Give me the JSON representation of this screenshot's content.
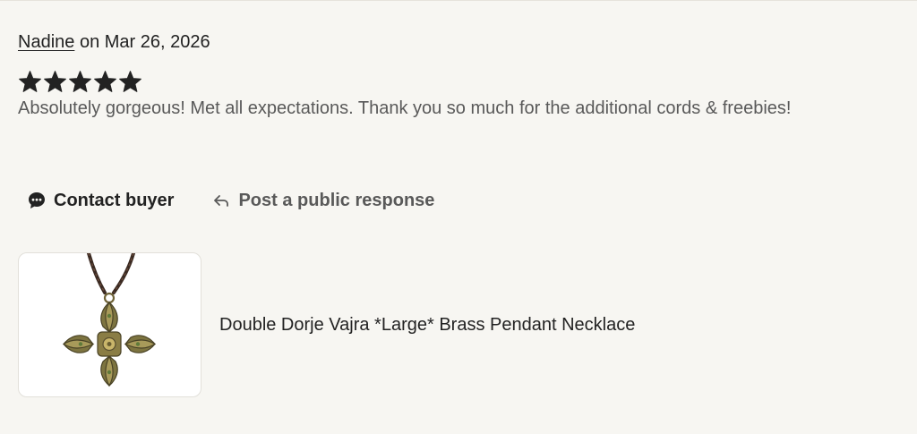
{
  "review": {
    "author": "Nadine",
    "date_prefix": "on",
    "date": "Mar 26, 2026",
    "rating": 5,
    "rating_max": 5,
    "text": "Absolutely gorgeous! Met all expectations. Thank you so much for the additional cords & freebies!"
  },
  "actions": {
    "contact_label": "Contact buyer",
    "contact_icon": "chat-bubble-icon",
    "respond_label": "Post a public response",
    "respond_icon": "reply-arrow-icon"
  },
  "product": {
    "title": "Double Dorje Vajra *Large* Brass Pendant Necklace",
    "image": "pendant-necklace-image"
  },
  "colors": {
    "background": "#f7f6f2",
    "text_primary": "#222222",
    "text_secondary": "#595959",
    "star": "#222222"
  }
}
